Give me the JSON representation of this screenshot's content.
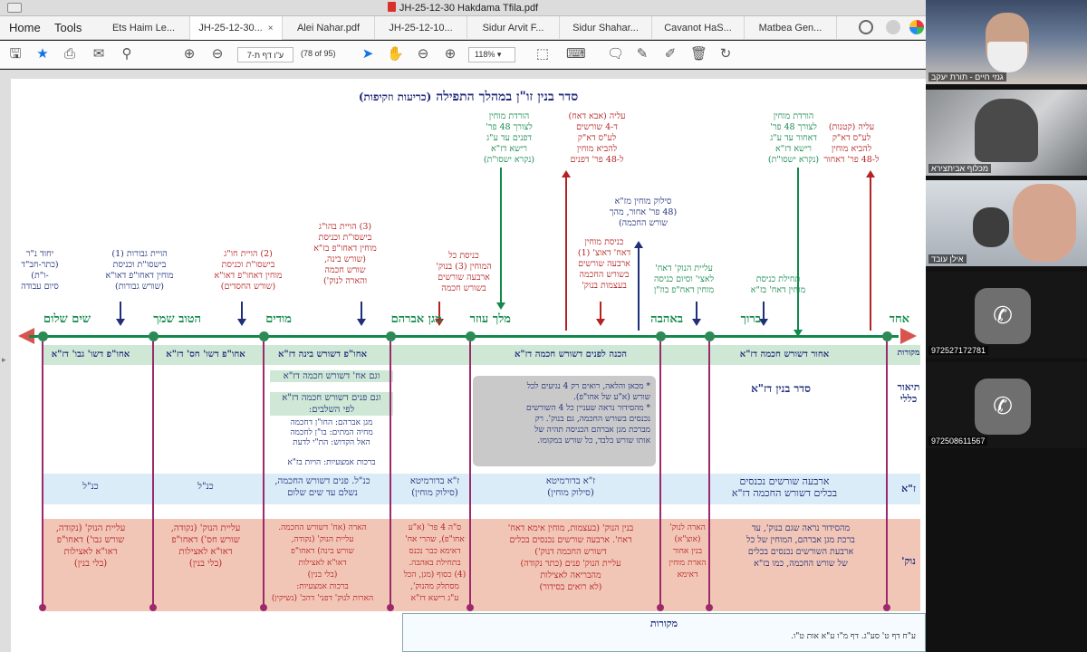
{
  "window": {
    "title": "JH-25-12-30 Hakdama Tfila.pdf"
  },
  "nav": {
    "home": "Home",
    "tools": "Tools"
  },
  "tabs": [
    {
      "label": "Ets Haim Le..."
    },
    {
      "label": "JH-25-12-30...",
      "close": "×"
    },
    {
      "label": "Alei Nahar.pdf"
    },
    {
      "label": "JH-25-12-10..."
    },
    {
      "label": "Sidur Arvit F..."
    },
    {
      "label": "Sidur Shahar..."
    },
    {
      "label": "Cavanot HaS..."
    },
    {
      "label": "Matbea Gen..."
    }
  ],
  "toolbar": {
    "page_input": "ע\"ו דף ת-7",
    "page_count": "(78 of 95)",
    "zoom": "118%"
  },
  "doc": {
    "title": "סדר בנין זו\"ן במהלך התפילה",
    "subtitle": "(כריעות וזקיפות)",
    "top_notes": [
      {
        "text": "עליה (קטנות)\nלע\"ס דא\"ק\nלהביא מוחין\nל-48 פר' דאחור",
        "cls": "red"
      },
      {
        "text": "הורדת מוחין\nלצורך 48 פר'\nדאחור עד ע\"ג\nרישא דז\"א\n(נקרא ישסו\"ת)",
        "cls": "green"
      },
      {
        "text": "סילוק מוחין מז\"א\n(48 פר' אחור, מהך\nשורש החכמה)",
        "cls": "navy"
      },
      {
        "text": "עליה (אבא דאח)\nד-4 שורשים\nלע\"ס דא\"ק\nלהביא מוחין\nל-48 פר' דפנים",
        "cls": "red"
      },
      {
        "text": "הורדת מוחין\nלצורך 48 פר'\nדפנים עד ע\"ג\nרישא דז\"א\n(נקרא ישסו\"ת)",
        "cls": "green"
      }
    ],
    "mid_notes": [
      {
        "text": "כניסת מוחין\nדאח' דאוצ' (1)\nארבעה שורשים\nבשורש החכמה\nבעצמות בנוק'",
        "cls": "red"
      },
      {
        "text": "עליית הנוק' דאח'\nלאצי' וסיום כניסה\nמוחין דאח\"פ בוז\"ן",
        "cls": "green"
      },
      {
        "text": "תחילת כניסת\nמוחין דאח' בז\"א",
        "cls": "green"
      },
      {
        "text": "כניסת כל\nהמוחין (3) בנוק'\nארבעה שורשים\nבשורש חכמה",
        "cls": "red"
      },
      {
        "text": "(3) הויית בהו\"ג\nבישסו\"ת וכניסת\nמוחין דאחו\"פ בז\"א\n(שורש בינה,\nשורש חכמה\nוהארה לנוק')",
        "cls": "red"
      },
      {
        "text": "(2) הויית חו\"ג\nבישסו\"ת וכניסת\nמוחין דאחו\"פ דאו\"א\n(שורש החסדים)",
        "cls": "red"
      },
      {
        "text": "הויית גבורות (1)\nבישסו\"ת וכניסת\nמוחין דאחו\"פ דאו\"א\n(שורש גבורות)",
        "cls": "navy"
      },
      {
        "text": "יחוד נ\"ר\n(כתר-חב\"ד\n-ו\"ת)\nסיום עבודה",
        "cls": "navy"
      }
    ],
    "stages": [
      "אחד",
      "ברוך",
      "באהבה",
      "מלך עוזר",
      "מגן אברהם",
      "מודים",
      "הטוב שמך",
      "שים שלום"
    ],
    "row_heads": {
      "sources": "מקורות",
      "description": "תיאור כללי",
      "za": "ז\"א",
      "nukva": "נוק'"
    },
    "row1": [
      "אחור דשורש חכמה דז\"א",
      "הכנה לפנים דשורש חכמה דז\"א",
      "אחו\"פ דשורש בינה דז\"א",
      "אחו\"פ דשו' חס' דז\"א",
      "אחו\"פ דשו' גבו' דז\"א"
    ],
    "desc_main": "סדר בנין דז\"א",
    "desc_side": [
      "וגם אח' דשורש חכמה דז\"א",
      "וגם פנים דשורש חכמה דז\"א\nלפי השלבים:",
      "מגן אברהם: החו\"ן דחכמה\nמחיה המתים: בו\"ן לחכמה\nהאל הקדוש: הת\"י לדעת",
      "ברכות אמצעיות: הויות בז\"א"
    ],
    "graybox": "* מכאן והלאה, רואים רק 4 נגיעים לכל\nשורש (א\"ע של אחו\"פ).\n* מהסידור נראה שעניין כל 4 השורשים\nנכנסים בשורש החכמה, גם בנוק'. רק\nמברכת מגן אברהם הכניסה תהיה של\nאותו שורש בלבד, כל שורש במקומו.",
    "za_cells": [
      "ארבעה שורשים נכנסים\nבכלים דשורש החכמה דז\"א",
      "ז\"א בדורמיטא\n(סילוק מוחין)",
      "ז\"א בדורמיטא\n(סילוק מוחין)",
      "כנ\"ל. פנים דשורש החכמה,\nנשלם עד שים שלום",
      "כנ\"ל",
      "כנ\"ל"
    ],
    "nuk_cells": [
      "מהסידור נראה שגם בנוק', עד\nברכת מגן אברהם, המוחין של כל\nארבעת השורשים נכנסים בכלים\nשל שורש החכמה, כמו בז\"א",
      "הארה לנוק'\n(אוצ\"א)\nבנין אחור\nהארת מוחין\nדאימא",
      "בנין הנוק' (בעצמות, מוחין אימא דאח'\nדאח'. ארבעה שורשים נכנסים בכלים\nדשורש החכמה דנוק')\nעליית הנוק' פנים (כתר נקודה)\nמהבריאה לאצילות\n(לא רואים בסידור)",
      "ס\"ה 4 פר' (א\"ע\nאחו\"פ), שהרי אח'\nדאימא כבר נכנס\nבתחילת באהבה.\n(4) כסוף (מגן, הכל\nמסתלק מהנוק',\nע\"ג רישא דז\"א",
      "הארה (אח' דשורש החכמה.\nעליית הנוק' (נקודה,\nשורש בינה) דאחו\"פ\nדאו\"א לאצילות\n(בלי בנין)\nברכות אמצעיות:\nהארות לנוק' דפני' דהכ' (נשיקין)",
      "עליית הנוק' (נקודה,\nשורש חס') דאחו\"פ\nדאו\"א לאצילות\n(בלי בנין)",
      "עליית הנוק' (נקודה,\nשורש גבו') דאחו\"פ\nדאו\"א לאצילות\n(בלי בנין)"
    ],
    "sources_title": "מקורות",
    "sources_text": "ע\"ח דף ט' סע\"ג. דף מ\"ו ע\"א אות ט\"ו."
  },
  "participants": [
    {
      "name": "גנזי חיים - תורת יעקב",
      "kind": "video"
    },
    {
      "name": "מכלוף אביתצירא",
      "kind": "video"
    },
    {
      "name": "אילן עובד",
      "kind": "video"
    },
    {
      "name": "972527172781",
      "kind": "phone"
    },
    {
      "name": "972508611567",
      "kind": "phone"
    }
  ]
}
